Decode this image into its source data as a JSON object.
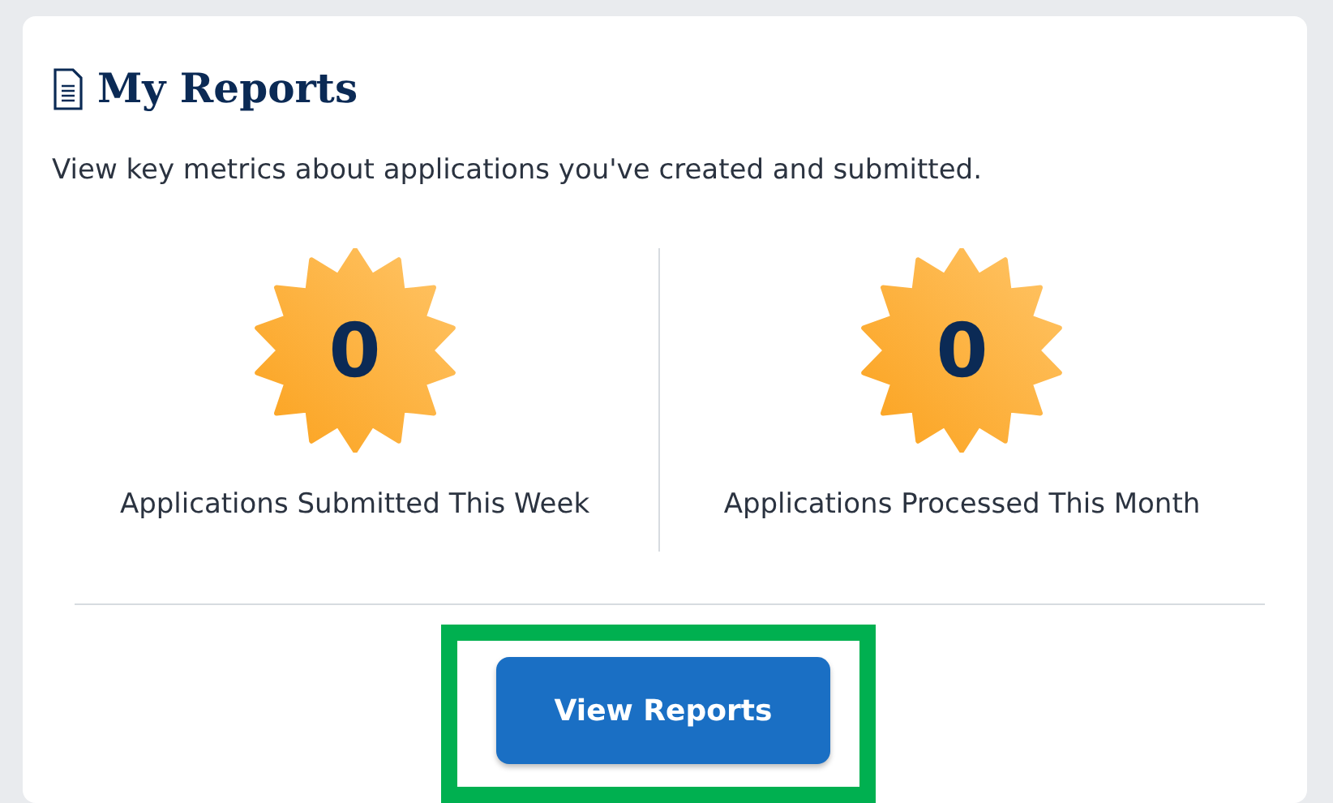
{
  "card": {
    "title": "My Reports",
    "description": "View key metrics about applications you've created and submitted.",
    "metrics": [
      {
        "value": "0",
        "label": "Applications Submitted This Week"
      },
      {
        "value": "0",
        "label": "Applications Processed This Month"
      }
    ],
    "button": {
      "label": "View Reports",
      "highlighted": true
    }
  }
}
